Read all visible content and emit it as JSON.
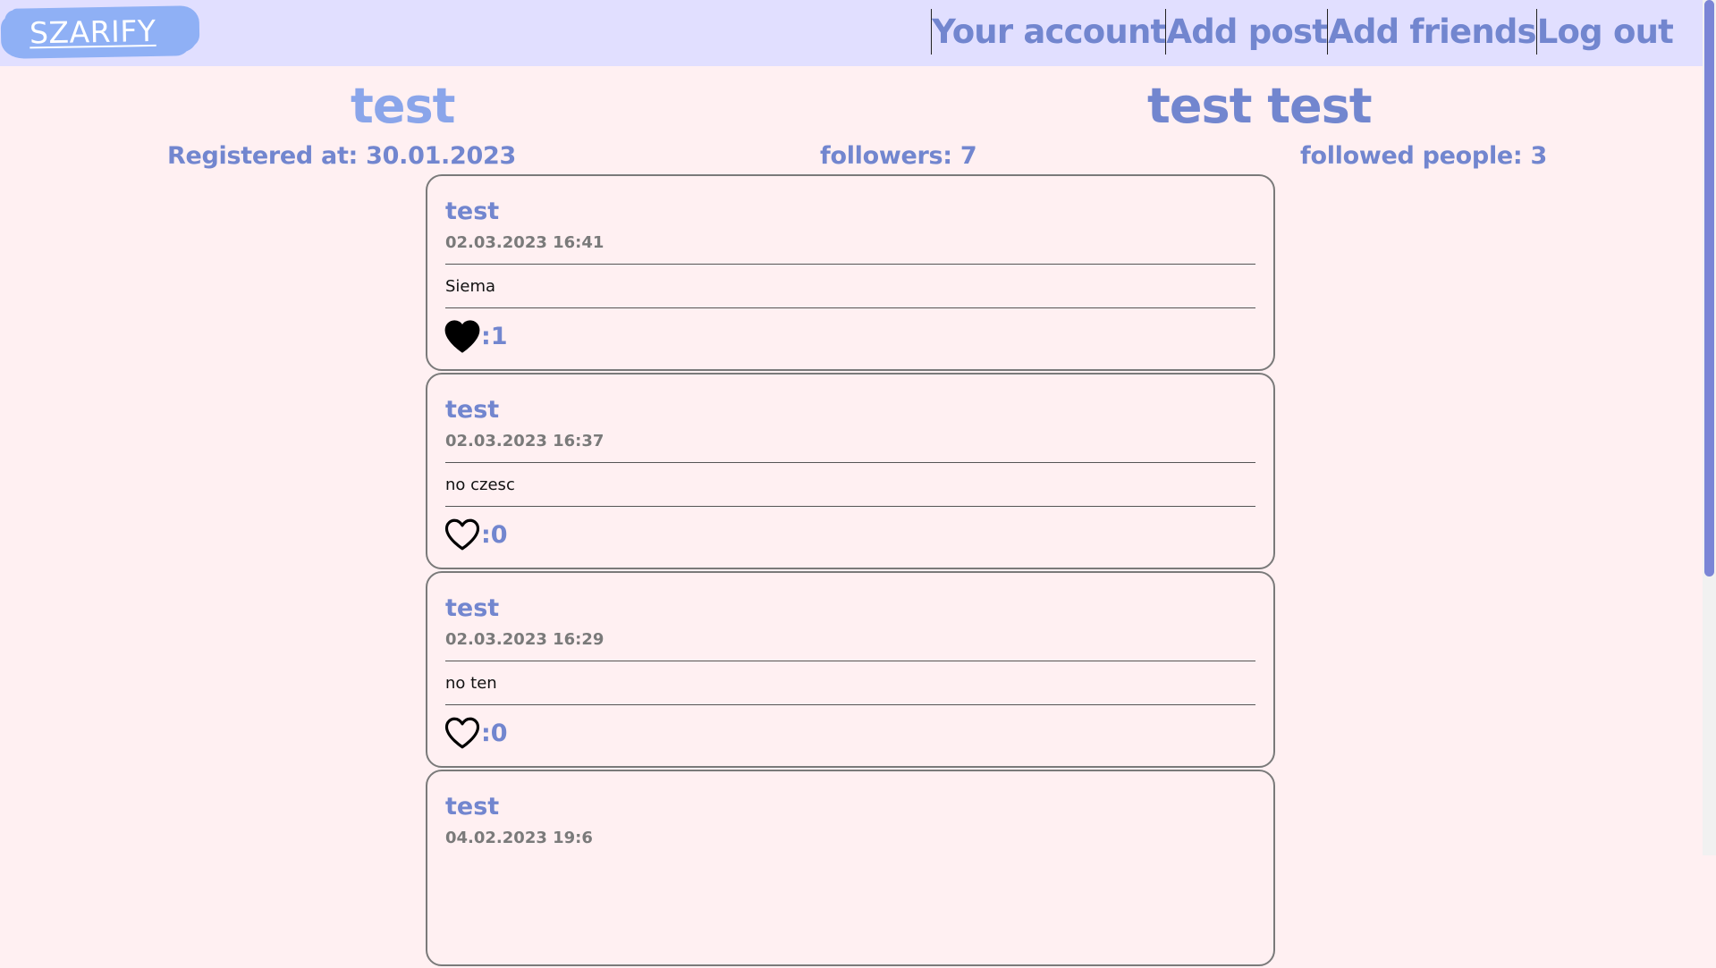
{
  "nav": {
    "logo": "SZARIFY",
    "links": [
      "Your account",
      "Add post",
      "Add friends",
      "Log out"
    ]
  },
  "profile": {
    "username": "test",
    "full_name": "test test",
    "registered": "Registered at: 30.01.2023",
    "followers": "followers: 7",
    "followed": "followed people: 3"
  },
  "posts": [
    {
      "author": "test",
      "date": "02.03.2023 16:41",
      "content": "Siema",
      "likes": ":1",
      "liked": true
    },
    {
      "author": "test",
      "date": "02.03.2023 16:37",
      "content": "no czesc",
      "likes": ":0",
      "liked": false
    },
    {
      "author": "test",
      "date": "02.03.2023 16:29",
      "content": "no ten",
      "likes": ":0",
      "liked": false
    },
    {
      "author": "test",
      "date": "04.02.2023 19:6",
      "content": "",
      "likes": "",
      "liked": false
    }
  ],
  "colors": {
    "accent": "#7286cf",
    "accent_light": "#8aa5ea",
    "navbar_bg": "#e1dfff",
    "page_bg": "#fff0f2",
    "logo_bg": "#8fb0f5"
  },
  "icons": {
    "like_filled": "heart-filled-icon",
    "like_empty": "heart-outline-icon"
  }
}
